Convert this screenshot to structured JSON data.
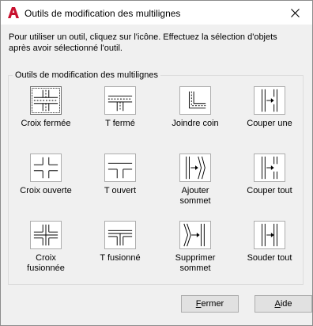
{
  "window": {
    "title": "Outils de modification des multilignes",
    "close_glyph": "✕"
  },
  "instructions": {
    "line1": "Pour utiliser un outil, cliquez sur l'icône. Effectuez la sélection d'objets",
    "line2": "après avoir sélectionné l'outil."
  },
  "group": {
    "title": "Outils de modification des multilignes"
  },
  "tools": [
    {
      "label": "Croix fermée",
      "icon": "closed-cross-icon"
    },
    {
      "label": "T fermé",
      "icon": "closed-tee-icon"
    },
    {
      "label": "Joindre coin",
      "icon": "corner-joint-icon"
    },
    {
      "label": "Couper une",
      "icon": "cut-single-icon"
    },
    {
      "label": "Croix ouverte",
      "icon": "open-cross-icon"
    },
    {
      "label": "T ouvert",
      "icon": "open-tee-icon"
    },
    {
      "label": "Ajouter\nsommet",
      "icon": "add-vertex-icon"
    },
    {
      "label": "Couper tout",
      "icon": "cut-all-icon"
    },
    {
      "label": "Croix\nfusionnée",
      "icon": "merged-cross-icon"
    },
    {
      "label": "T fusionné",
      "icon": "merged-tee-icon"
    },
    {
      "label": "Supprimer\nsommet",
      "icon": "delete-vertex-icon"
    },
    {
      "label": "Souder tout",
      "icon": "weld-all-icon"
    }
  ],
  "buttons": {
    "close_first": "F",
    "close_rest": "ermer",
    "help_first": "A",
    "help_rest": "ide"
  },
  "colors": {
    "app_icon_red": "#c8102e"
  }
}
